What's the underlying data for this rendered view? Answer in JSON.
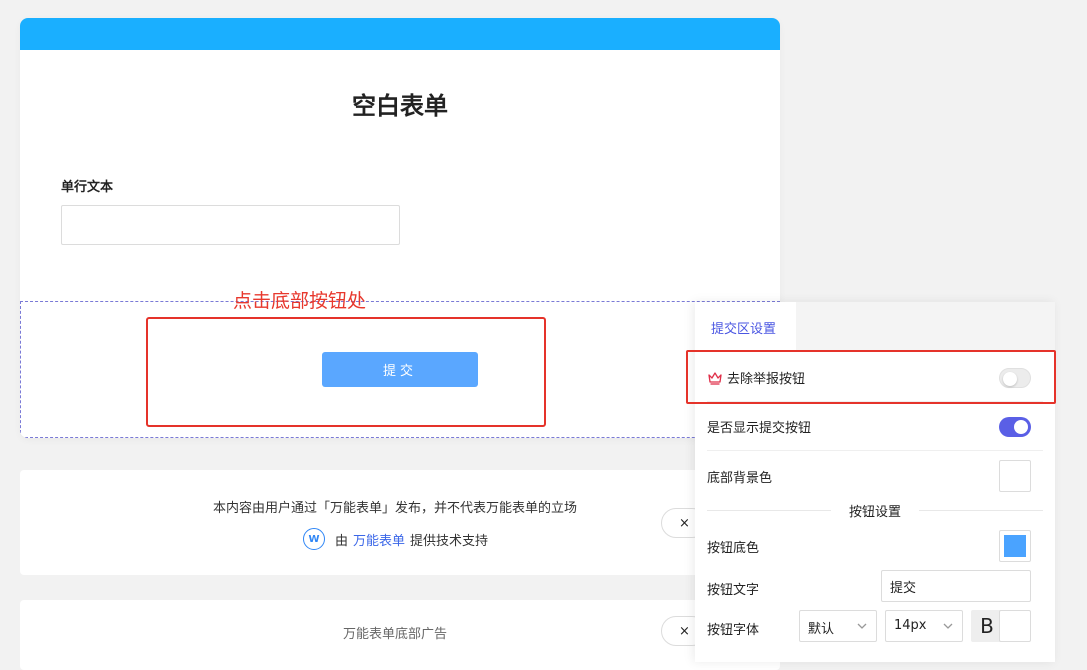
{
  "form": {
    "title": "空白表单",
    "field_label": "单行文本",
    "field_value": "",
    "submit_label": "提交"
  },
  "annotation": {
    "hint": "点击底部按钮处"
  },
  "disclaimer": {
    "text": "本内容由用户通过「万能表单」发布，并不代表万能表单的立场",
    "powered_prefix": "由",
    "powered_brand": "万能表单",
    "powered_suffix": "提供技术支持",
    "logo_text": "W"
  },
  "ad": {
    "text": "万能表单底部广告"
  },
  "close_label": "×",
  "panel": {
    "tab": "提交区设置",
    "remove_report_label": "去除举报按钮",
    "remove_report_enabled": false,
    "show_submit_label": "是否显示提交按钮",
    "show_submit_enabled": true,
    "bottom_bg_label": "底部背景色",
    "bottom_bg_color": "#ffffff",
    "button_section_title": "按钮设置",
    "button_bg_label": "按钮底色",
    "button_bg_color": "#4aa3ff",
    "button_text_label": "按钮文字",
    "button_text_value": "提交",
    "button_font_label": "按钮字体",
    "font_family_value": "默认",
    "font_size_value": "14px",
    "bold_label": "B",
    "font_color": "#ffffff"
  },
  "colors": {
    "header_bar": "#1aafff",
    "submit_button": "#5aa7ff",
    "accent": "#5a5fe6",
    "annotation_red": "#e5332a",
    "crown": "#e0304a"
  }
}
